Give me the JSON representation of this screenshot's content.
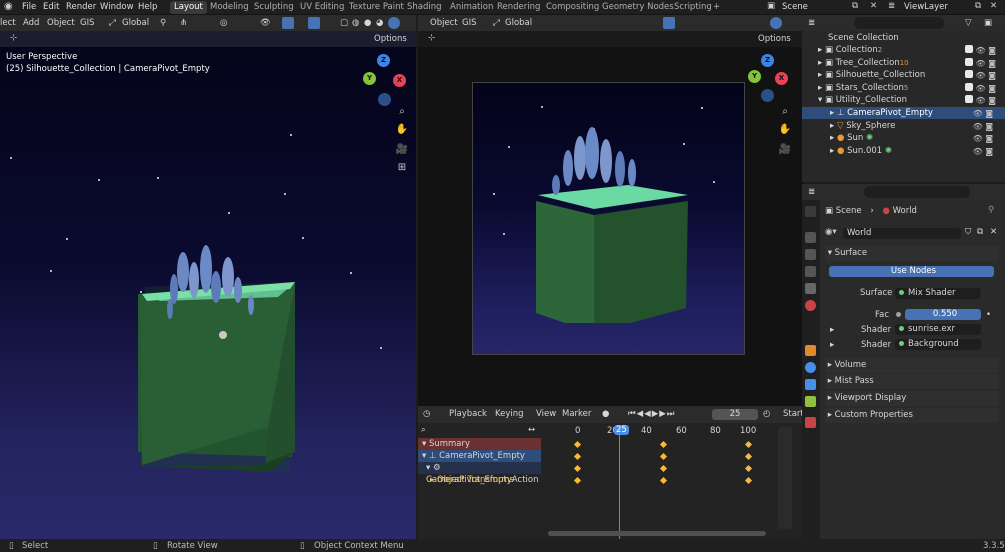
{
  "menu": [
    "File",
    "Edit",
    "Render",
    "Window",
    "Help"
  ],
  "workspaces": [
    "Layout",
    "Modeling",
    "Sculpting",
    "UV Editing",
    "Texture Paint",
    "Shading",
    "Animation",
    "Rendering",
    "Compositing",
    "Geometry Nodes",
    "Scripting"
  ],
  "active_workspace": "Layout",
  "add_tab": "+",
  "scene_name": "Scene",
  "view_layer": "ViewLayer",
  "viewport_left": {
    "menu": [
      "lect",
      "Add",
      "Object",
      "GIS"
    ],
    "transform": "Global",
    "options": "Options",
    "info_line1": "User Perspective",
    "info_line2": "(25) Silhouette_Collection | CameraPivot_Empty"
  },
  "viewport_right": {
    "menu": [
      "Object",
      "GIS"
    ],
    "transform": "Global",
    "options": "Options"
  },
  "outliner": {
    "root": "Scene Collection",
    "items": [
      {
        "label": "Collection",
        "badge": "2",
        "indent": 0
      },
      {
        "label": "Tree_Collection",
        "badge": "10",
        "indent": 0
      },
      {
        "label": "Silhouette_Collection",
        "badge": "",
        "indent": 0
      },
      {
        "label": "Stars_Collection",
        "badge": "5",
        "indent": 0
      },
      {
        "label": "Utility_Collection",
        "badge": "",
        "indent": 0
      },
      {
        "label": "CameraPivot_Empty",
        "badge": "",
        "indent": 1
      },
      {
        "label": "Sky_Sphere",
        "badge": "",
        "indent": 1
      },
      {
        "label": "Sun",
        "badge": "",
        "indent": 1
      },
      {
        "label": "Sun.001",
        "badge": "",
        "indent": 1
      }
    ]
  },
  "properties": {
    "breadcrumb": [
      "Scene",
      "World"
    ],
    "world_name": "World",
    "surface_panel": "Surface",
    "use_nodes": "Use Nodes",
    "surface_label": "Surface",
    "surface_value": "Mix Shader",
    "fac_label": "Fac",
    "fac_value": "0.550",
    "shader1_label": "Shader",
    "shader1_value": "sunrise.exr",
    "shader2_label": "Shader",
    "shader2_value": "Background",
    "panels": [
      "Volume",
      "Mist Pass",
      "Viewport Display",
      "Custom Properties"
    ]
  },
  "timeline": {
    "menu": [
      "Playback",
      "Keying",
      "View",
      "Marker"
    ],
    "current_frame": "25",
    "start_label": "Start",
    "ruler": [
      "0",
      "20",
      "25",
      "40",
      "60",
      "80",
      "100"
    ],
    "channels": [
      "Summary",
      "CameraPivot_Empty",
      "CameraPivot_EmptyAction",
      "Object Transforms"
    ]
  },
  "status": {
    "select": "Select",
    "rotate": "Rotate View",
    "context": "Object Context Menu",
    "version": "3.3.5"
  },
  "colors": {
    "accent": "#4772b3",
    "keyframe": "#f5b93b",
    "playhead": "#4a8ee8",
    "summary_bg": "#6b3132",
    "active_row": "#2e4d7a",
    "gizmo_x": "#e84258",
    "gizmo_y": "#85c33a",
    "gizmo_z": "#3b85e8"
  }
}
